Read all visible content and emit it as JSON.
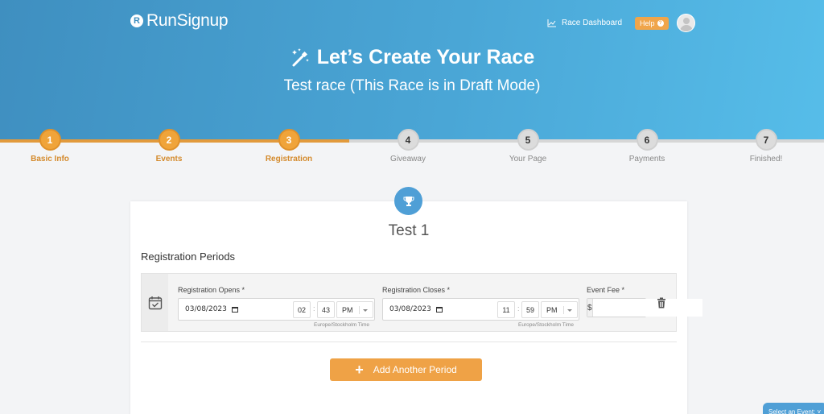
{
  "brand": {
    "name": "RunSignup",
    "mark": "R"
  },
  "topnav": {
    "dashboard_label": "Race Dashboard",
    "help_label": "Help",
    "help_icon": "?"
  },
  "hero": {
    "title": "Let’s Create Your Race",
    "subtitle": "Test race (This Race is in Draft Mode)"
  },
  "colors": {
    "primary": "#4aa6d6",
    "accent": "#f0a43a",
    "inactive": "#dcdcdc"
  },
  "steps": [
    {
      "num": "1",
      "label": "Basic Info",
      "state": "complete"
    },
    {
      "num": "2",
      "label": "Events",
      "state": "complete"
    },
    {
      "num": "3",
      "label": "Registration",
      "state": "current"
    },
    {
      "num": "4",
      "label": "Giveaway",
      "state": "upcoming"
    },
    {
      "num": "5",
      "label": "Your Page",
      "state": "upcoming"
    },
    {
      "num": "6",
      "label": "Payments",
      "state": "upcoming"
    },
    {
      "num": "7",
      "label": "Finished!",
      "state": "upcoming"
    }
  ],
  "event": {
    "name": "Test 1",
    "section_title": "Registration Periods",
    "period": {
      "opens": {
        "label": "Registration Opens *",
        "date": "03/08/2023",
        "hour": "02",
        "minute": "43",
        "ampm": "PM",
        "timezone": "Europe/Stockholm Time"
      },
      "closes": {
        "label": "Registration Closes *",
        "date": "03/08/2023",
        "hour": "11",
        "minute": "59",
        "ampm": "PM",
        "timezone": "Europe/Stockholm Time"
      },
      "fee": {
        "label": "Event Fee *",
        "prefix": "$",
        "value": ""
      }
    },
    "add_button": "Add Another Period"
  },
  "select_event": "Select an Event: ˅"
}
